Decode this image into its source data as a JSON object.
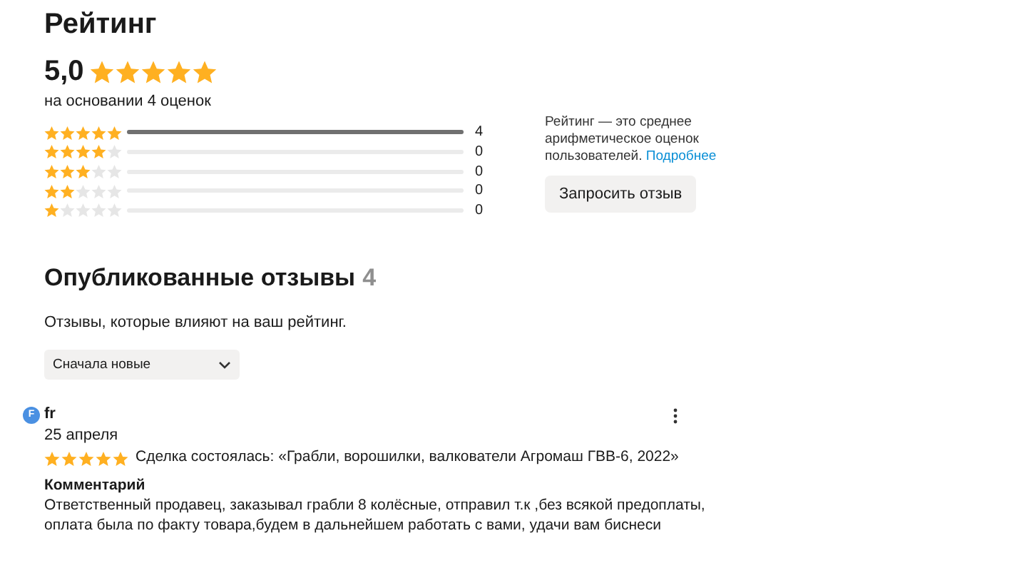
{
  "title": "Рейтинг",
  "rating": {
    "value": "5,0",
    "stars": 5,
    "basis": "на основании 4 оценок"
  },
  "distribution": [
    {
      "stars": 5,
      "level": 1,
      "count": "4"
    },
    {
      "stars": 4,
      "level": 0,
      "count": "0"
    },
    {
      "stars": 3,
      "level": 0,
      "count": "0"
    },
    {
      "stars": 2,
      "level": 0,
      "count": "0"
    },
    {
      "stars": 1,
      "level": 0,
      "count": "0"
    }
  ],
  "info": {
    "text": "Рейтинг — это среднее арифметическое оценок пользователей.",
    "link": "Подробнее"
  },
  "request_button": "Запросить отзыв",
  "published": {
    "title": "Опубликованные отзывы",
    "count": "4",
    "subtitle": "Отзывы, которые влияют на ваш рейтинг.",
    "sort": "Сначала новые"
  },
  "reviews": [
    {
      "avatar_letter": "F",
      "author": "fr",
      "date": "25 апреля",
      "stars": 5,
      "deal": "Сделка состоялась: «Грабли, ворошилки, валкователи Агромаш ГВВ-6, 2022»",
      "comment_label": "Комментарий",
      "comment": "Ответственный продавец, заказывал грабли 8 колёсные, отправил т.к ,без всякой предоплаты, оплата была по факту товара,будем в дальнейшем работать с вами, удачи вам биснеси"
    }
  ]
}
